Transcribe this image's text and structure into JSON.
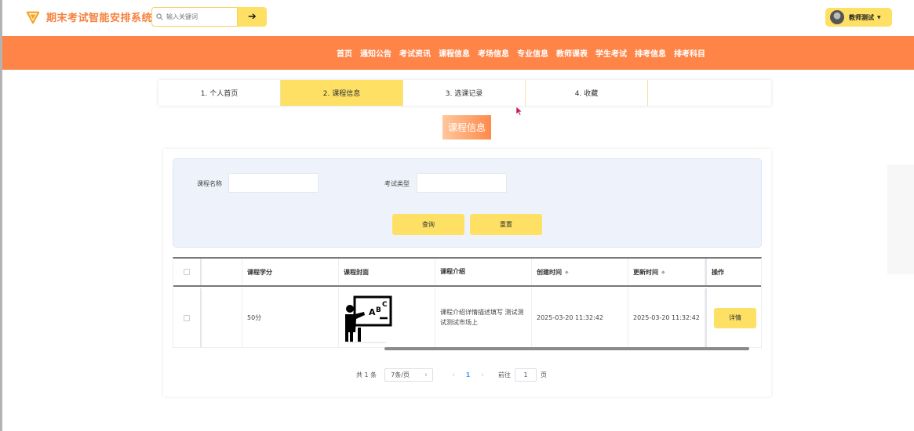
{
  "header": {
    "app_title": "期末考试智能安排系统",
    "search_placeholder": "输入关键词",
    "search_button_icon": "arrow-right-icon",
    "user_name": "教师测试",
    "accent_color": "#fde064",
    "brand_color": "#ff8447"
  },
  "nav": {
    "items": [
      "首页",
      "通知公告",
      "考试资讯",
      "课程信息",
      "考场信息",
      "专业信息",
      "教师课表",
      "学生考试",
      "排考信息",
      "排考科目"
    ]
  },
  "steps": [
    {
      "label": "1. 个人首页",
      "active": false
    },
    {
      "label": "2. 课程信息",
      "active": true
    },
    {
      "label": "3. 选课记录",
      "active": false
    },
    {
      "label": "4. 收藏",
      "active": false
    }
  ],
  "section_title": "课程信息",
  "filter": {
    "course_name_label": "课程名称",
    "course_name_value": "",
    "exam_type_label": "考试类型",
    "exam_type_value": "",
    "query_button": "查询",
    "reset_button": "重置"
  },
  "table": {
    "headers": [
      "",
      "",
      "课程学分",
      "课程封面",
      "课程介绍",
      "创建时间",
      "更新时间",
      "操作"
    ],
    "rows": [
      {
        "credit": "50分",
        "cover_icon": "teacher-blackboard-icon",
        "intro": "课程介绍详情描述填写 测试测试测试市场上",
        "created": "2025-03-20 11:32:42",
        "updated": "2025-03-20 11:32:42",
        "action": "详情"
      }
    ]
  },
  "pager": {
    "total_text": "共 1 条",
    "page_size": "7条/页",
    "current_page": "1",
    "goto_prefix": "前往",
    "goto_value": "1",
    "goto_suffix": "页"
  }
}
